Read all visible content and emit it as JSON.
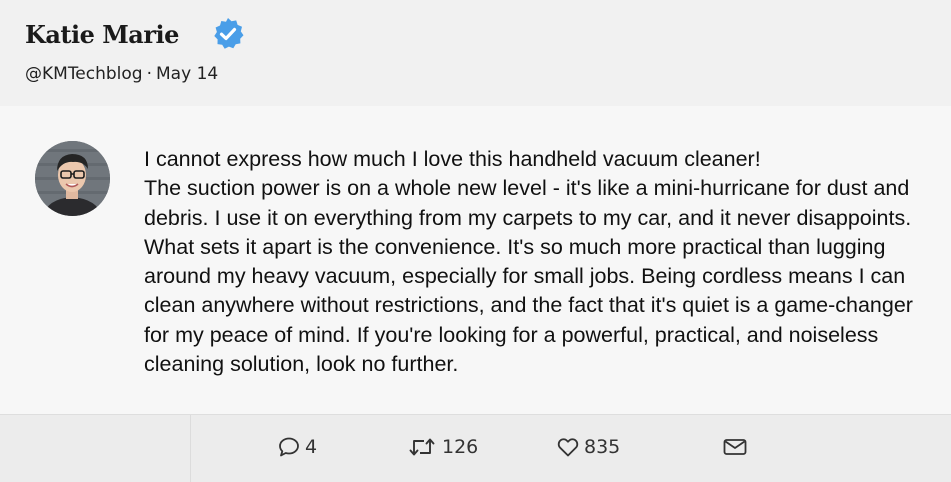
{
  "tweet": {
    "author": {
      "name": "Katie Marie",
      "handle": "@KMTechblog",
      "date": "May 14",
      "separator": "·",
      "verified": true,
      "verified_color": "#4a9ee8"
    },
    "text": {
      "line1": "I cannot express how much I love this handheld vacuum cleaner!",
      "line2": "The suction power is on a whole new level - it's like a mini-hurricane for dust and debris. I use it on everything from my carpets to my car, and it never disappoints. What sets it apart is the convenience. It's so much more practical than lugging around my heavy vacuum, especially for small jobs. Being cordless means I can clean anywhere without restrictions, and the fact that it's quiet is a game-changer for my peace of mind. If you're looking for a powerful, practical, and noiseless cleaning solution, look no further."
    },
    "actions": {
      "replies": {
        "icon": "reply-icon",
        "count": "4"
      },
      "retweets": {
        "icon": "retweet-icon",
        "count": "126"
      },
      "likes": {
        "icon": "heart-icon",
        "count": "835"
      },
      "share": {
        "icon": "envelope-icon"
      }
    }
  },
  "colors": {
    "header_bg": "#f1f1f1",
    "content_bg": "#f7f7f7",
    "footer_bg": "#ececec",
    "text": "#111111"
  }
}
